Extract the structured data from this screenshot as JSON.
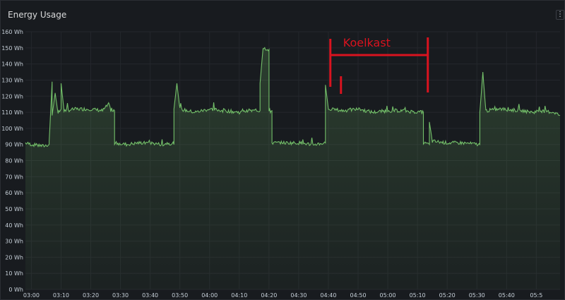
{
  "panel": {
    "title": "Energy Usage",
    "menu_icon": "vertical-ellipsis-icon"
  },
  "colors": {
    "line": "#73bf69",
    "annotation": "#d9131f",
    "grid": "#24272c",
    "axis_text": "#c7d0d9"
  },
  "chart_data": {
    "type": "line",
    "title": "",
    "xlabel": "",
    "ylabel": "",
    "grid": true,
    "legend": "none",
    "ylim": [
      0,
      160
    ],
    "xlim": [
      "02:58",
      "05:58"
    ],
    "y_ticks": [
      "0 Wh",
      "10 Wh",
      "20 Wh",
      "30 Wh",
      "40 Wh",
      "50 Wh",
      "60 Wh",
      "70 Wh",
      "80 Wh",
      "90 Wh",
      "100 Wh",
      "110 Wh",
      "120 Wh",
      "130 Wh",
      "140 Wh",
      "150 Wh",
      "160 Wh"
    ],
    "x_ticks": [
      "03:00",
      "03:10",
      "03:20",
      "03:30",
      "03:40",
      "03:50",
      "04:00",
      "04:10",
      "04:20",
      "04:30",
      "04:40",
      "04:50",
      "05:00",
      "05:10",
      "05:20",
      "05:30",
      "05:40",
      "05:5"
    ],
    "series": [
      {
        "values": [
          [
            "02:58",
            91
          ],
          [
            "03:00",
            90
          ],
          [
            "03:04",
            89
          ],
          [
            "03:06",
            90
          ],
          [
            "03:06",
            92
          ],
          [
            "03:07",
            129
          ],
          [
            "03:07",
            108
          ],
          [
            "03:08",
            122
          ],
          [
            "03:09",
            109
          ],
          [
            "03:10",
            112
          ],
          [
            "03:10",
            128
          ],
          [
            "03:11",
            111
          ],
          [
            "03:15",
            112
          ],
          [
            "03:20",
            112
          ],
          [
            "03:24",
            111
          ],
          [
            "03:26",
            115
          ],
          [
            "03:27",
            110
          ],
          [
            "03:28",
            111
          ],
          [
            "03:28",
            91
          ],
          [
            "03:32",
            90
          ],
          [
            "03:36",
            91
          ],
          [
            "03:40",
            91
          ],
          [
            "03:44",
            90
          ],
          [
            "03:46",
            91
          ],
          [
            "03:48",
            90
          ],
          [
            "03:48",
            112
          ],
          [
            "03:49",
            128
          ],
          [
            "03:50",
            112
          ],
          [
            "03:55",
            110
          ],
          [
            "04:00",
            112
          ],
          [
            "04:05",
            111
          ],
          [
            "04:10",
            110
          ],
          [
            "04:15",
            111
          ],
          [
            "04:17",
            111
          ],
          [
            "04:17",
            128
          ],
          [
            "04:18",
            150
          ],
          [
            "04:20",
            149
          ],
          [
            "04:20",
            110
          ],
          [
            "04:21",
            111
          ],
          [
            "04:21",
            91
          ],
          [
            "04:25",
            91
          ],
          [
            "04:30",
            91
          ],
          [
            "04:35",
            90
          ],
          [
            "04:39",
            91
          ],
          [
            "04:39",
            127
          ],
          [
            "04:40",
            112
          ],
          [
            "04:45",
            111
          ],
          [
            "04:50",
            112
          ],
          [
            "04:55",
            110
          ],
          [
            "05:00",
            111
          ],
          [
            "05:05",
            111
          ],
          [
            "05:11",
            110
          ],
          [
            "05:12",
            110
          ],
          [
            "05:12",
            91
          ],
          [
            "05:14",
            90
          ],
          [
            "05:14",
            104
          ],
          [
            "05:15",
            92
          ],
          [
            "05:20",
            91
          ],
          [
            "05:25",
            91
          ],
          [
            "05:31",
            90
          ],
          [
            "05:31",
            110
          ],
          [
            "05:32",
            135
          ],
          [
            "05:33",
            111
          ],
          [
            "05:38",
            112
          ],
          [
            "05:45",
            111
          ],
          [
            "05:49",
            110
          ],
          [
            "05:51",
            111
          ],
          [
            "05:56",
            110
          ],
          [
            "05:58",
            108
          ]
        ]
      }
    ],
    "annotations": [
      {
        "text": "Koelkast",
        "from": "04:39",
        "to": "05:13"
      }
    ]
  }
}
